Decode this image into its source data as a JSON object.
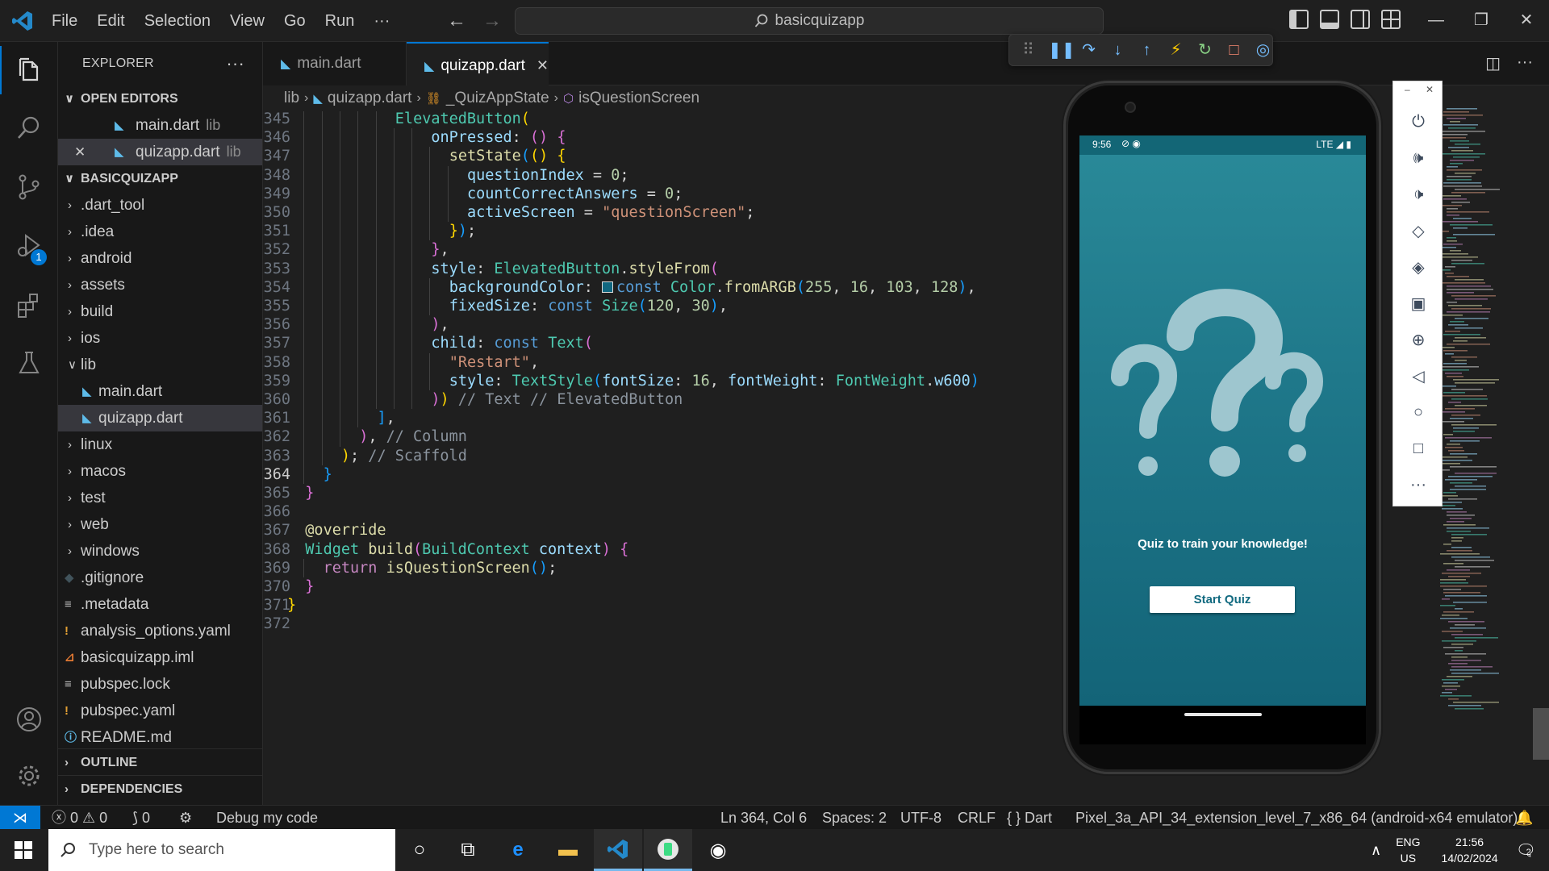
{
  "window": {
    "search_text": "basicquizapp",
    "menu": [
      "File",
      "Edit",
      "Selection",
      "View",
      "Go",
      "Run",
      "···"
    ]
  },
  "activity": {
    "debug_badge": "1"
  },
  "sidebar": {
    "title": "EXPLORER",
    "open_editors_label": "OPEN EDITORS",
    "open_editors": [
      {
        "name": "main.dart",
        "desc": "lib"
      },
      {
        "name": "quizapp.dart",
        "desc": "lib"
      }
    ],
    "project_label": "BASICQUIZAPP",
    "tree": [
      {
        "name": ".dart_tool",
        "type": "folder"
      },
      {
        "name": ".idea",
        "type": "folder"
      },
      {
        "name": "android",
        "type": "folder"
      },
      {
        "name": "assets",
        "type": "folder"
      },
      {
        "name": "build",
        "type": "folder"
      },
      {
        "name": "ios",
        "type": "folder"
      },
      {
        "name": "lib",
        "type": "folder-open"
      },
      {
        "name": "main.dart",
        "type": "dart"
      },
      {
        "name": "quizapp.dart",
        "type": "dart"
      },
      {
        "name": "linux",
        "type": "folder"
      },
      {
        "name": "macos",
        "type": "folder"
      },
      {
        "name": "test",
        "type": "folder"
      },
      {
        "name": "web",
        "type": "folder"
      },
      {
        "name": "windows",
        "type": "folder"
      },
      {
        "name": ".gitignore",
        "type": "git"
      },
      {
        "name": ".metadata",
        "type": "meta"
      },
      {
        "name": "analysis_options.yaml",
        "type": "yaml"
      },
      {
        "name": "basicquizapp.iml",
        "type": "xml"
      },
      {
        "name": "pubspec.lock",
        "type": "meta"
      },
      {
        "name": "pubspec.yaml",
        "type": "yaml"
      },
      {
        "name": "README.md",
        "type": "info"
      }
    ],
    "outline_label": "OUTLINE",
    "dependencies_label": "DEPENDENCIES"
  },
  "tabs": [
    {
      "label": "main.dart",
      "active": false
    },
    {
      "label": "quizapp.dart",
      "active": true
    }
  ],
  "breadcrumb": [
    "lib",
    "quizapp.dart",
    "_QuizAppState",
    "isQuestionScreen"
  ],
  "editor": {
    "current_line": 364,
    "lines": [
      {
        "n": 345,
        "indent": 6,
        "tokens": [
          [
            "k-cls",
            "ElevatedButton"
          ],
          [
            "b1",
            "("
          ]
        ]
      },
      {
        "n": 346,
        "indent": 8,
        "tokens": [
          [
            "k-var",
            "onPressed"
          ],
          [
            "k-p",
            ": "
          ],
          [
            "b2",
            "()"
          ],
          [
            "k-p",
            " "
          ],
          [
            "b2",
            "{"
          ]
        ]
      },
      {
        "n": 347,
        "indent": 9,
        "tokens": [
          [
            "k-fn",
            "setState"
          ],
          [
            "b3",
            "("
          ],
          [
            "b1",
            "()"
          ],
          [
            "k-p",
            " "
          ],
          [
            "b1",
            "{"
          ]
        ]
      },
      {
        "n": 348,
        "indent": 10,
        "tokens": [
          [
            "k-var",
            "questionIndex"
          ],
          [
            "k-p",
            " = "
          ],
          [
            "k-num",
            "0"
          ],
          [
            "k-p",
            ";"
          ]
        ]
      },
      {
        "n": 349,
        "indent": 10,
        "tokens": [
          [
            "k-var",
            "countCorrectAnswers"
          ],
          [
            "k-p",
            " = "
          ],
          [
            "k-num",
            "0"
          ],
          [
            "k-p",
            ";"
          ]
        ]
      },
      {
        "n": 350,
        "indent": 10,
        "tokens": [
          [
            "k-var",
            "activeScreen"
          ],
          [
            "k-p",
            " = "
          ],
          [
            "k-str",
            "\"questionScreen\""
          ],
          [
            "k-p",
            ";"
          ]
        ]
      },
      {
        "n": 351,
        "indent": 9,
        "tokens": [
          [
            "b1",
            "}"
          ],
          [
            "b3",
            ")"
          ],
          [
            "k-p",
            ";"
          ]
        ]
      },
      {
        "n": 352,
        "indent": 8,
        "tokens": [
          [
            "b2",
            "}"
          ],
          [
            "k-p",
            ","
          ]
        ]
      },
      {
        "n": 353,
        "indent": 8,
        "tokens": [
          [
            "k-var",
            "style"
          ],
          [
            "k-p",
            ": "
          ],
          [
            "k-cls",
            "ElevatedButton"
          ],
          [
            "k-p",
            "."
          ],
          [
            "k-fn",
            "styleFrom"
          ],
          [
            "b2",
            "("
          ]
        ]
      },
      {
        "n": 354,
        "indent": 9,
        "tokens": [
          [
            "k-var",
            "backgroundColor"
          ],
          [
            "k-p",
            ": "
          ],
          [
            "swatch",
            ""
          ],
          [
            "k-kw",
            "const"
          ],
          [
            "k-p",
            " "
          ],
          [
            "k-cls",
            "Color"
          ],
          [
            "k-p",
            "."
          ],
          [
            "k-fn",
            "fromARGB"
          ],
          [
            "b3",
            "("
          ],
          [
            "k-num",
            "255"
          ],
          [
            "k-p",
            ", "
          ],
          [
            "k-num",
            "16"
          ],
          [
            "k-p",
            ", "
          ],
          [
            "k-num",
            "103"
          ],
          [
            "k-p",
            ", "
          ],
          [
            "k-num",
            "128"
          ],
          [
            "b3",
            ")"
          ],
          [
            "k-p",
            ","
          ]
        ]
      },
      {
        "n": 355,
        "indent": 9,
        "tokens": [
          [
            "k-var",
            "fixedSize"
          ],
          [
            "k-p",
            ": "
          ],
          [
            "k-kw",
            "const"
          ],
          [
            "k-p",
            " "
          ],
          [
            "k-cls",
            "Size"
          ],
          [
            "b3",
            "("
          ],
          [
            "k-num",
            "120"
          ],
          [
            "k-p",
            ", "
          ],
          [
            "k-num",
            "30"
          ],
          [
            "b3",
            ")"
          ],
          [
            "k-p",
            ","
          ]
        ]
      },
      {
        "n": 356,
        "indent": 8,
        "tokens": [
          [
            "b2",
            ")"
          ],
          [
            "k-p",
            ","
          ]
        ]
      },
      {
        "n": 357,
        "indent": 8,
        "tokens": [
          [
            "k-var",
            "child"
          ],
          [
            "k-p",
            ": "
          ],
          [
            "k-kw",
            "const"
          ],
          [
            "k-p",
            " "
          ],
          [
            "k-cls",
            "Text"
          ],
          [
            "b2",
            "("
          ]
        ]
      },
      {
        "n": 358,
        "indent": 9,
        "tokens": [
          [
            "k-str",
            "\"Restart\""
          ],
          [
            "k-p",
            ","
          ]
        ]
      },
      {
        "n": 359,
        "indent": 9,
        "tokens": [
          [
            "k-var",
            "style"
          ],
          [
            "k-p",
            ": "
          ],
          [
            "k-cls",
            "TextStyle"
          ],
          [
            "b3",
            "("
          ],
          [
            "k-var",
            "fontSize"
          ],
          [
            "k-p",
            ": "
          ],
          [
            "k-num",
            "16"
          ],
          [
            "k-p",
            ", "
          ],
          [
            "k-var",
            "fontWeight"
          ],
          [
            "k-p",
            ": "
          ],
          [
            "k-cls",
            "FontWeight"
          ],
          [
            "k-p",
            "."
          ],
          [
            "k-var",
            "w600"
          ],
          [
            "b3",
            ")"
          ]
        ]
      },
      {
        "n": 360,
        "indent": 8,
        "tokens": [
          [
            "b2",
            ")"
          ],
          [
            "b1",
            ")"
          ],
          [
            "k-cmt",
            " // Text // ElevatedButton"
          ]
        ]
      },
      {
        "n": 361,
        "indent": 5,
        "tokens": [
          [
            "b3",
            "]"
          ],
          [
            "k-p",
            ","
          ]
        ]
      },
      {
        "n": 362,
        "indent": 4,
        "tokens": [
          [
            "b2",
            ")"
          ],
          [
            "k-p",
            ","
          ],
          [
            "k-cmt",
            " // Column"
          ]
        ]
      },
      {
        "n": 363,
        "indent": 3,
        "tokens": [
          [
            "b1",
            ")"
          ],
          [
            "k-p",
            ";"
          ],
          [
            "k-cmt",
            " // Scaffold"
          ]
        ]
      },
      {
        "n": 364,
        "indent": 2,
        "tokens": [
          [
            "b3",
            "}"
          ]
        ]
      },
      {
        "n": 365,
        "indent": 1,
        "tokens": [
          [
            "b2",
            "}"
          ]
        ]
      },
      {
        "n": 366,
        "indent": 0,
        "tokens": []
      },
      {
        "n": 367,
        "indent": 1,
        "tokens": [
          [
            "k-fn",
            "@override"
          ]
        ]
      },
      {
        "n": 368,
        "indent": 1,
        "tokens": [
          [
            "k-cls",
            "Widget"
          ],
          [
            "k-p",
            " "
          ],
          [
            "k-fn",
            "build"
          ],
          [
            "b2",
            "("
          ],
          [
            "k-cls",
            "BuildContext"
          ],
          [
            "k-p",
            " "
          ],
          [
            "k-var",
            "context"
          ],
          [
            "b2",
            ")"
          ],
          [
            "k-p",
            " "
          ],
          [
            "b2",
            "{"
          ]
        ]
      },
      {
        "n": 369,
        "indent": 2,
        "tokens": [
          [
            "k-ctl",
            "return"
          ],
          [
            "k-p",
            " "
          ],
          [
            "k-fn",
            "isQuestionScreen"
          ],
          [
            "b3",
            "()"
          ],
          [
            "k-p",
            ";"
          ]
        ]
      },
      {
        "n": 370,
        "indent": 1,
        "tokens": [
          [
            "b2",
            "}"
          ]
        ]
      },
      {
        "n": 371,
        "indent": 0,
        "tokens": [
          [
            "b1",
            "}"
          ]
        ]
      },
      {
        "n": 372,
        "indent": 0,
        "tokens": []
      }
    ]
  },
  "emulator": {
    "status_time": "9:56",
    "status_network": "LTE",
    "title": "Quiz to train your knowledge!",
    "button_label": "Start Quiz",
    "accent_color": "#106780"
  },
  "statusbar": {
    "errors": "0",
    "warnings": "0",
    "ports": "0",
    "debug_label": "Debug my code",
    "position": "Ln 364, Col 6",
    "spaces": "Spaces: 2",
    "encoding": "UTF-8",
    "eol": "CRLF",
    "language": "Dart",
    "device": "Pixel_3a_API_34_extension_level_7_x86_64 (android-x64 emulator)"
  },
  "taskbar": {
    "search_placeholder": "Type here to search",
    "lang_top": "ENG",
    "lang_bottom": "US",
    "time": "21:56",
    "date": "14/02/2024",
    "notif_count": "2"
  }
}
